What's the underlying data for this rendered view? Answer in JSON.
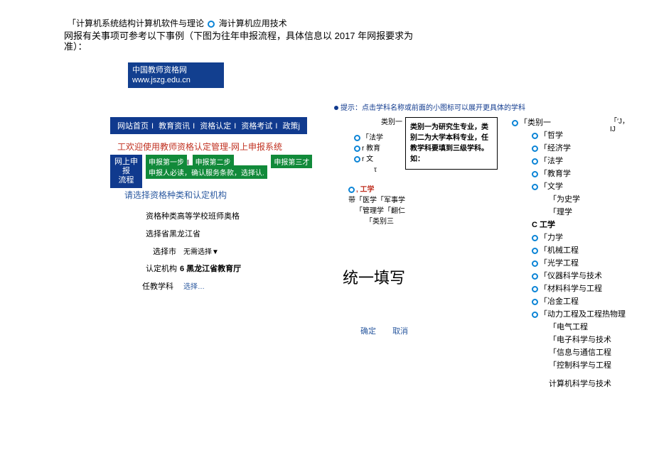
{
  "top": {
    "line1_a": "「计算机系统结构计算机软件与理论",
    "line1_b": "海计算机应用技术",
    "line2": "网报有关事项可参考以下事例（下图为往年申报流程，具体信息以 2017 年网报要求为",
    "line3": "准）："
  },
  "site": {
    "name": "中国教师资格网",
    "url": "www.jszg.edu.cn"
  },
  "nav": [
    "网站首页",
    "教育资讯",
    "资格认定",
    "资格考试",
    "政策j"
  ],
  "welcome": "工欢迎使用教师资格认定管理-网上申报系统",
  "wslabel": "网上申报\n流程",
  "steps": {
    "a": "申报第一步",
    "b": "申报第二步",
    "c": "申报第三才",
    "must": "申报人必读，确认服务条款，选择认."
  },
  "choose_title": "请选择资格种类和认定机构",
  "form": {
    "r1": "资格种类高等学校班师奥格",
    "r2": "选择省黑龙江省",
    "r3": "选择市",
    "r3v": "无需选择▼",
    "r4": "认定机构",
    "r4v": "6 黑龙江省教育厅",
    "r5": "任教学科",
    "r5v": "选择…"
  },
  "center": {
    "hint": "提示：点击学科名称或前面的小图标可以展开更具体的学科",
    "lbl1": "类别一",
    "o1": "「法学",
    "o2": "r 教育",
    "o3": "r 文",
    "o4": "τ",
    "note": "类别一为研究生专业，类别二为大学本科专业，任教学科要填到三级学科。如：",
    "l1": ", 工学",
    "l2": "带「医学「军事学",
    "l3": "「管理学「翻仁",
    "l4": "「类别三"
  },
  "fill": "统一填写",
  "confirm": {
    "ok": "确定",
    "cancel": "取消"
  },
  "topcorner": "「′J，\nIJ",
  "tree": {
    "root": "「类别一",
    "items": [
      {
        "lvl": 2,
        "dot": true,
        "txt": "「哲学"
      },
      {
        "lvl": 2,
        "dot": true,
        "txt": "「经济学"
      },
      {
        "lvl": 2,
        "dot": true,
        "txt": "「法学"
      },
      {
        "lvl": 2,
        "dot": true,
        "txt": "「教育学"
      },
      {
        "lvl": 2,
        "dot": true,
        "txt": "「文学"
      },
      {
        "lvl": 3,
        "dot": false,
        "txt": "「为史学"
      },
      {
        "lvl": 3,
        "dot": false,
        "txt": "「理学"
      },
      {
        "lvl": 2,
        "dot": false,
        "bold": true,
        "txt": "C 工学"
      },
      {
        "lvl": 2,
        "dot": true,
        "txt": "「力学"
      },
      {
        "lvl": 2,
        "dot": true,
        "txt": "「机械工程"
      },
      {
        "lvl": 2,
        "dot": true,
        "txt": "「光学工程"
      },
      {
        "lvl": 2,
        "dot": true,
        "txt": "「仪器科学与技术"
      },
      {
        "lvl": 2,
        "dot": true,
        "txt": "「材料科学与工程"
      },
      {
        "lvl": 2,
        "dot": true,
        "txt": "「冶金工程"
      },
      {
        "lvl": 2,
        "dot": true,
        "txt": "「动力工程及工程热物理"
      },
      {
        "lvl": 3,
        "dot": false,
        "txt": "「电气工程"
      },
      {
        "lvl": 3,
        "dot": false,
        "txt": "「电子科学与技术"
      },
      {
        "lvl": 3,
        "dot": false,
        "txt": "「信息与通信工程"
      },
      {
        "lvl": 3,
        "dot": false,
        "txt": "「控制科学与工程"
      },
      {
        "lvl": 3,
        "dot": false,
        "txt": "计算机科学与技术",
        "pad": true
      }
    ]
  }
}
